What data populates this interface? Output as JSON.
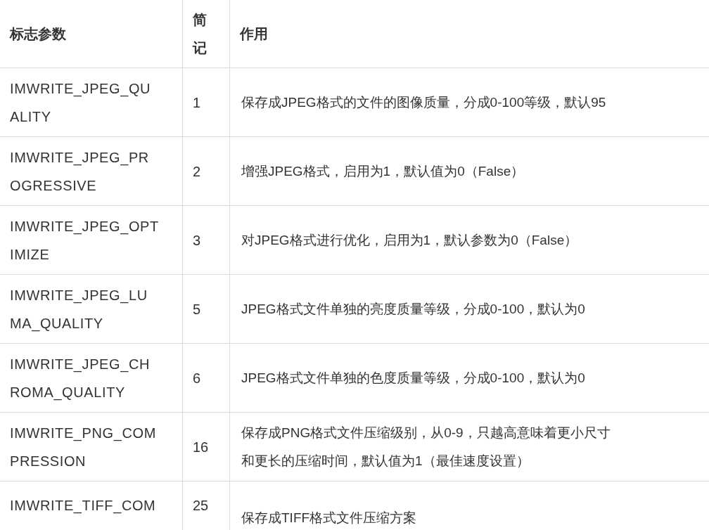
{
  "table": {
    "columns": [
      {
        "lines": [
          "标志参数"
        ]
      },
      {
        "lines": [
          "简",
          "记"
        ]
      },
      {
        "lines": [
          "作用"
        ]
      }
    ],
    "rows": [
      {
        "param": [
          "IMWRITE_JPEG_QU",
          "ALITY"
        ],
        "code": [
          "1"
        ],
        "effect": [
          "保存成JPEG格式的文件的图像质量，分成0-100等级，默认95"
        ]
      },
      {
        "param": [
          "IMWRITE_JPEG_PR",
          "OGRESSIVE"
        ],
        "code": [
          "2"
        ],
        "effect": [
          "增强JPEG格式，启用为1，默认值为0（False）"
        ]
      },
      {
        "param": [
          "IMWRITE_JPEG_OPT",
          "IMIZE"
        ],
        "code": [
          "3"
        ],
        "effect": [
          "对JPEG格式进行优化，启用为1，默认参数为0（False）"
        ]
      },
      {
        "param": [
          "IMWRITE_JPEG_LU",
          "MA_QUALITY"
        ],
        "code": [
          "5"
        ],
        "effect": [
          "JPEG格式文件单独的亮度质量等级，分成0-100，默认为0"
        ]
      },
      {
        "param": [
          "IMWRITE_JPEG_CH",
          "ROMA_QUALITY"
        ],
        "code": [
          "6"
        ],
        "effect": [
          "JPEG格式文件单独的色度质量等级，分成0-100，默认为0"
        ]
      },
      {
        "param": [
          "IMWRITE_PNG_COM",
          "PRESSION"
        ],
        "code": [
          "16"
        ],
        "effect": [
          "保存成PNG格式文件压缩级别，从0-9，只越高意味着更小尺寸",
          "和更长的压缩时间，默认值为1（最佳速度设置）"
        ]
      },
      {
        "param": [
          "IMWRITE_TIFF_COM"
        ],
        "code": [
          "25"
        ],
        "effect": [
          "保存成TIFF格式文件压缩方案"
        ]
      }
    ]
  }
}
